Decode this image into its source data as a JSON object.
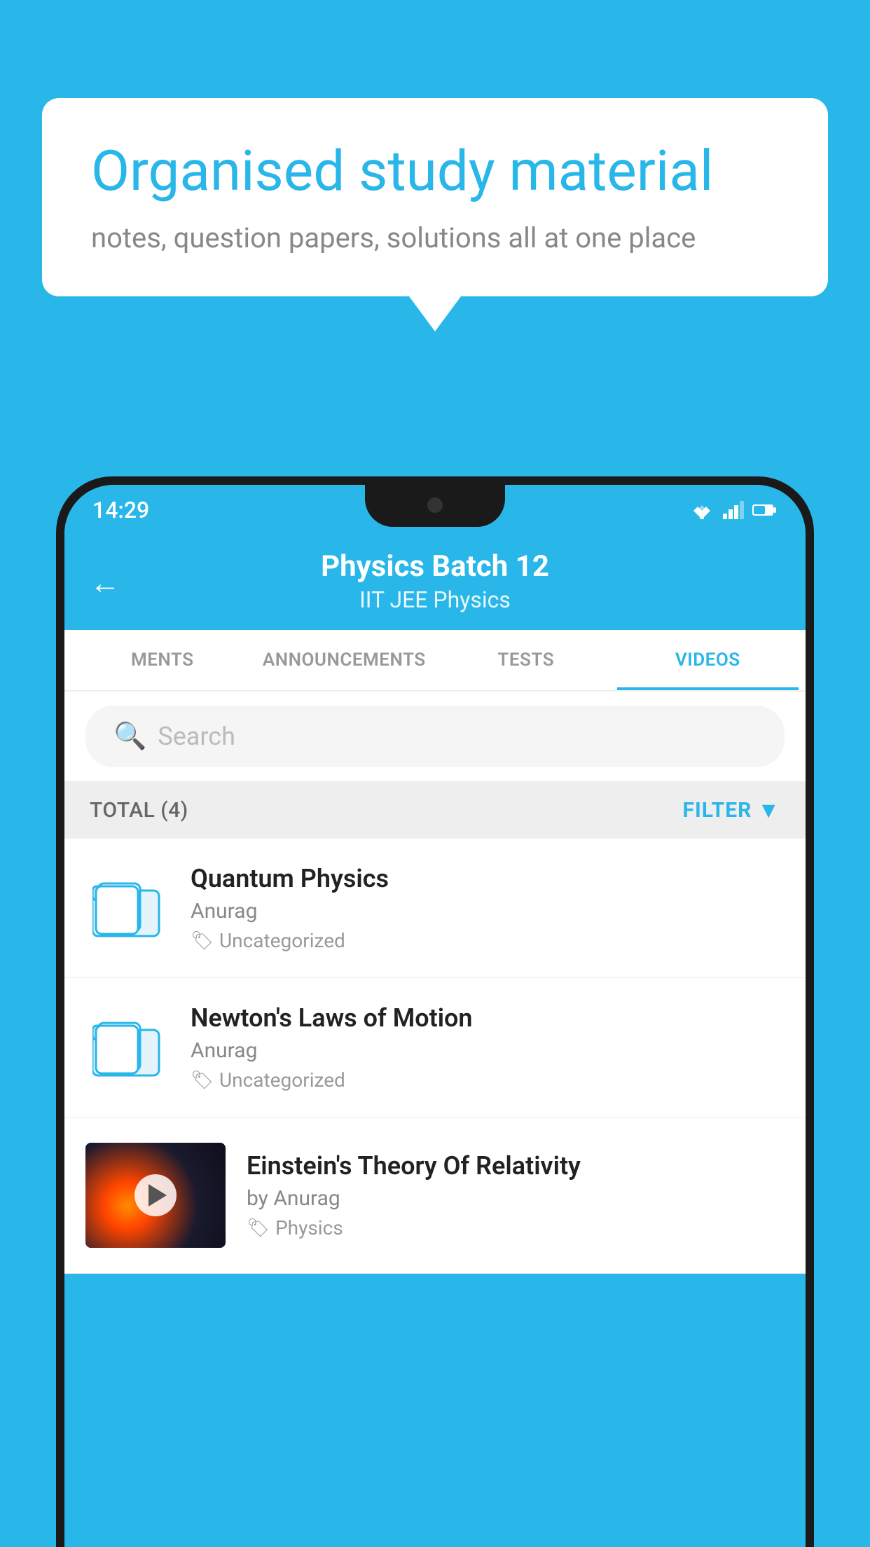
{
  "background_color": "#29b6e8",
  "speech_bubble": {
    "headline": "Organised study material",
    "subtext": "notes, question papers, solutions all at one place"
  },
  "status_bar": {
    "time": "14:29",
    "wifi_icon": "wifi",
    "signal_icon": "signal",
    "battery_icon": "battery"
  },
  "app_bar": {
    "title": "Physics Batch 12",
    "subtitle": "IIT JEE   Physics",
    "back_label": "←"
  },
  "tabs": [
    {
      "label": "MENTS",
      "active": false
    },
    {
      "label": "ANNOUNCEMENTS",
      "active": false
    },
    {
      "label": "TESTS",
      "active": false
    },
    {
      "label": "VIDEOS",
      "active": true
    }
  ],
  "search": {
    "placeholder": "Search"
  },
  "filter_bar": {
    "total_label": "TOTAL (4)",
    "filter_label": "FILTER"
  },
  "video_items": [
    {
      "id": "quantum",
      "title": "Quantum Physics",
      "author": "Anurag",
      "tag": "Uncategorized",
      "has_thumbnail": false
    },
    {
      "id": "newton",
      "title": "Newton's Laws of Motion",
      "author": "Anurag",
      "tag": "Uncategorized",
      "has_thumbnail": false
    },
    {
      "id": "einstein",
      "title": "Einstein's Theory Of Relativity",
      "author": "by Anurag",
      "tag": "Physics",
      "has_thumbnail": true
    }
  ]
}
